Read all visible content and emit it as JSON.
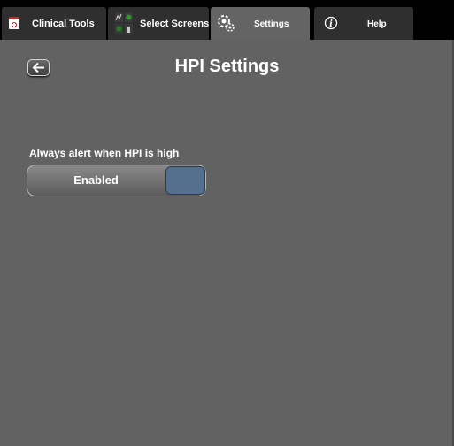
{
  "tabs": [
    {
      "label": "Clinical Tools",
      "icon": "clinical-tools-icon"
    },
    {
      "label": "Select Screens",
      "icon": "select-screens-icon"
    },
    {
      "label": "Settings",
      "icon": "settings-gear-icon",
      "active": true
    },
    {
      "label": "Help",
      "icon": "info-icon"
    }
  ],
  "header": {
    "title": "HPI Settings",
    "back_icon": "back-arrow-icon"
  },
  "setting": {
    "label": "Always alert when HPI is high",
    "value": "Enabled",
    "accent": "#55708e"
  }
}
